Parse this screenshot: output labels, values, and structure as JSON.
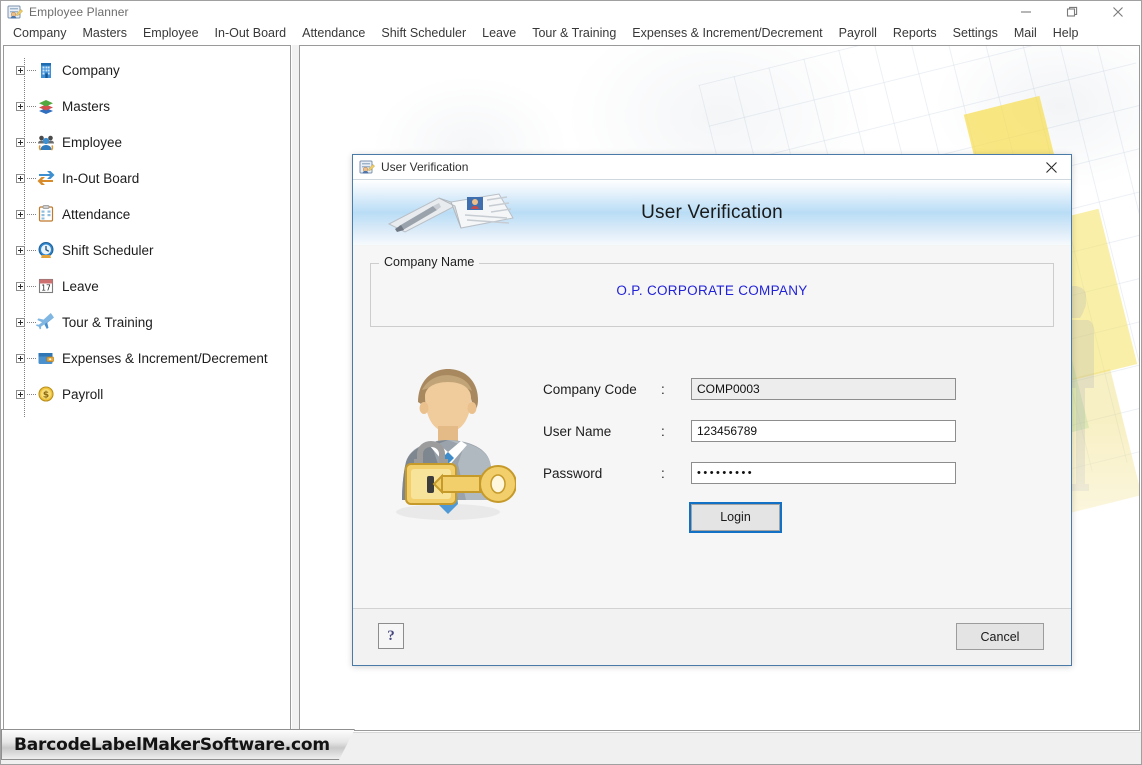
{
  "window": {
    "title": "Employee Planner",
    "icon": "employee-planner-icon",
    "minimize_label": "Minimize",
    "maximize_label": "Maximize",
    "close_label": "Close"
  },
  "menubar": {
    "items": [
      {
        "label": "Company"
      },
      {
        "label": "Masters"
      },
      {
        "label": "Employee"
      },
      {
        "label": "In-Out Board"
      },
      {
        "label": "Attendance"
      },
      {
        "label": "Shift Scheduler"
      },
      {
        "label": "Leave"
      },
      {
        "label": "Tour & Training"
      },
      {
        "label": "Expenses & Increment/Decrement"
      },
      {
        "label": "Payroll"
      },
      {
        "label": "Reports"
      },
      {
        "label": "Settings"
      },
      {
        "label": "Mail"
      },
      {
        "label": "Help"
      }
    ]
  },
  "tree": {
    "nodes": [
      {
        "label": "Company",
        "icon": "building-icon",
        "expander": "plus"
      },
      {
        "label": "Masters",
        "icon": "layers-icon",
        "expander": "plus"
      },
      {
        "label": "Employee",
        "icon": "people-icon",
        "expander": "plus"
      },
      {
        "label": "In-Out Board",
        "icon": "in-out-arrows-icon",
        "expander": "plus"
      },
      {
        "label": "Attendance",
        "icon": "clipboard-icon",
        "expander": "plus"
      },
      {
        "label": "Shift Scheduler",
        "icon": "clock-icon",
        "expander": "plus"
      },
      {
        "label": "Leave",
        "icon": "calendar-17-icon",
        "expander": "plus"
      },
      {
        "label": "Tour & Training",
        "icon": "airplane-icon",
        "expander": "plus"
      },
      {
        "label": "Expenses & Increment/Decrement",
        "icon": "wallet-icon",
        "expander": "plus"
      },
      {
        "label": "Payroll",
        "icon": "dollar-coin-icon",
        "expander": "plus"
      }
    ]
  },
  "dialog": {
    "title": "User Verification",
    "title_icon": "user-verification-icon",
    "banner_title": "User Verification",
    "banner_icon": "open-book-pen-icon",
    "close_label": "Close",
    "avatar_icon": "user-lock-key-icon",
    "group": {
      "legend": "Company Name",
      "company_name": "O.P. CORPORATE COMPANY"
    },
    "fields": [
      {
        "label": "Company Code",
        "separator": ":",
        "value": "COMP0003",
        "placeholder": "",
        "readonly": true,
        "type": "text"
      },
      {
        "label": "User Name",
        "separator": ":",
        "value": "123456789",
        "placeholder": "",
        "readonly": false,
        "type": "text"
      },
      {
        "label": "Password",
        "separator": ":",
        "value": "•••••••••",
        "placeholder": "",
        "readonly": false,
        "type": "password"
      }
    ],
    "login_button": "Login",
    "help_button": "?",
    "cancel_button": "Cancel"
  },
  "watermark": {
    "text": "BarcodeLabelMakerSoftware.com"
  },
  "colors": {
    "accent_blue": "#1271c4",
    "company_text": "#2222d8",
    "dialog_border": "#4a7aa8",
    "banner_blue": "#b9ddf6"
  }
}
